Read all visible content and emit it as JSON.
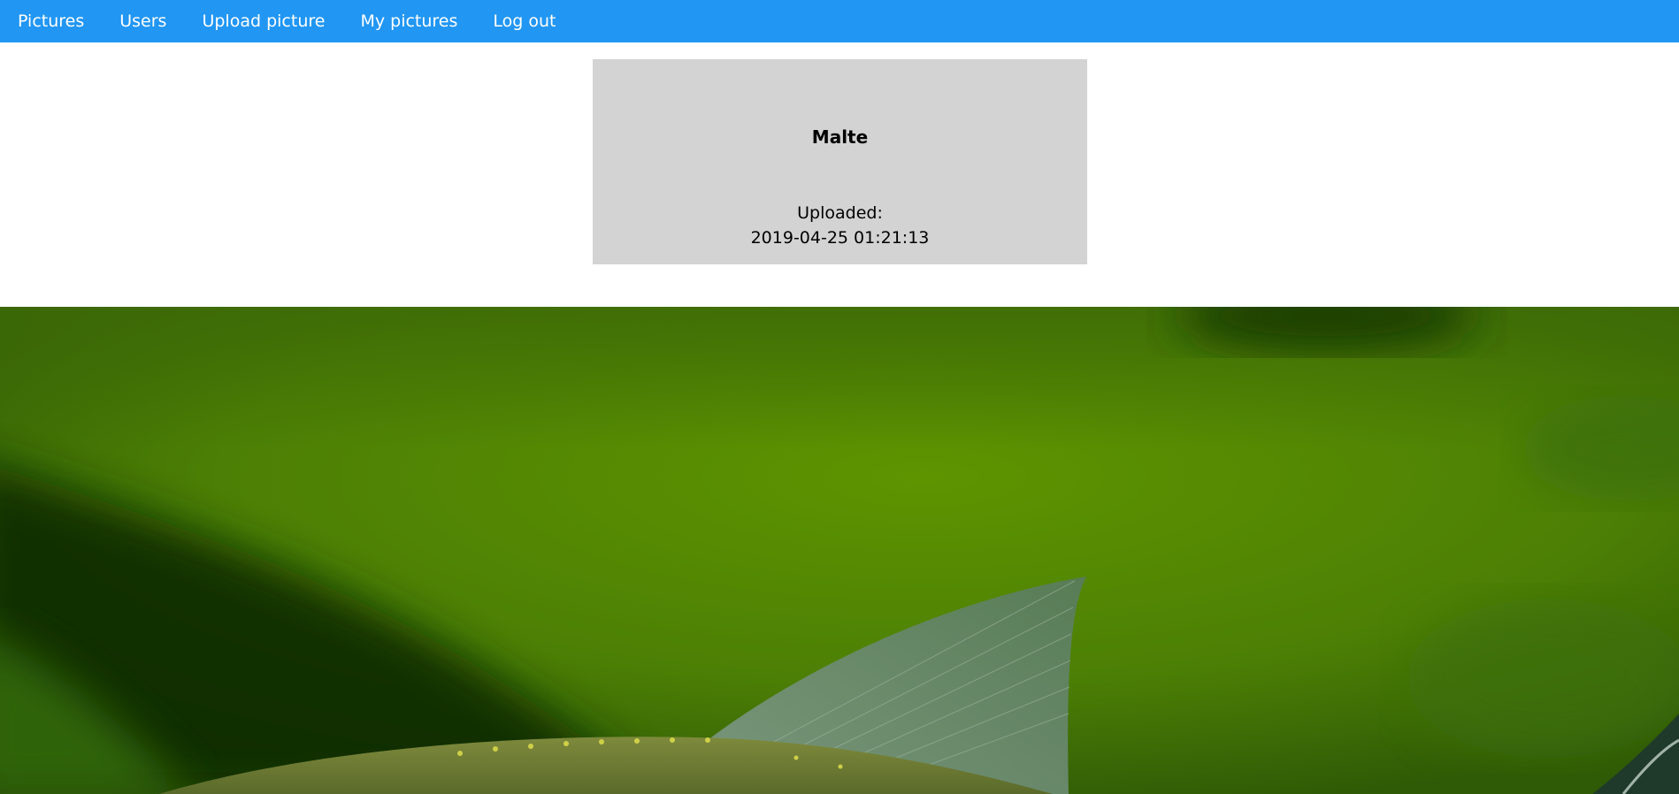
{
  "nav": {
    "items": [
      {
        "label": "Pictures"
      },
      {
        "label": "Users"
      },
      {
        "label": "Upload picture"
      },
      {
        "label": "My pictures"
      },
      {
        "label": "Log out"
      }
    ],
    "background": "#2196F3"
  },
  "picture_info": {
    "username": "Malte",
    "uploaded_label": "Uploaded:",
    "uploaded_at": "2019-04-25 01:21:13",
    "card_color": "#d3d3d3"
  }
}
